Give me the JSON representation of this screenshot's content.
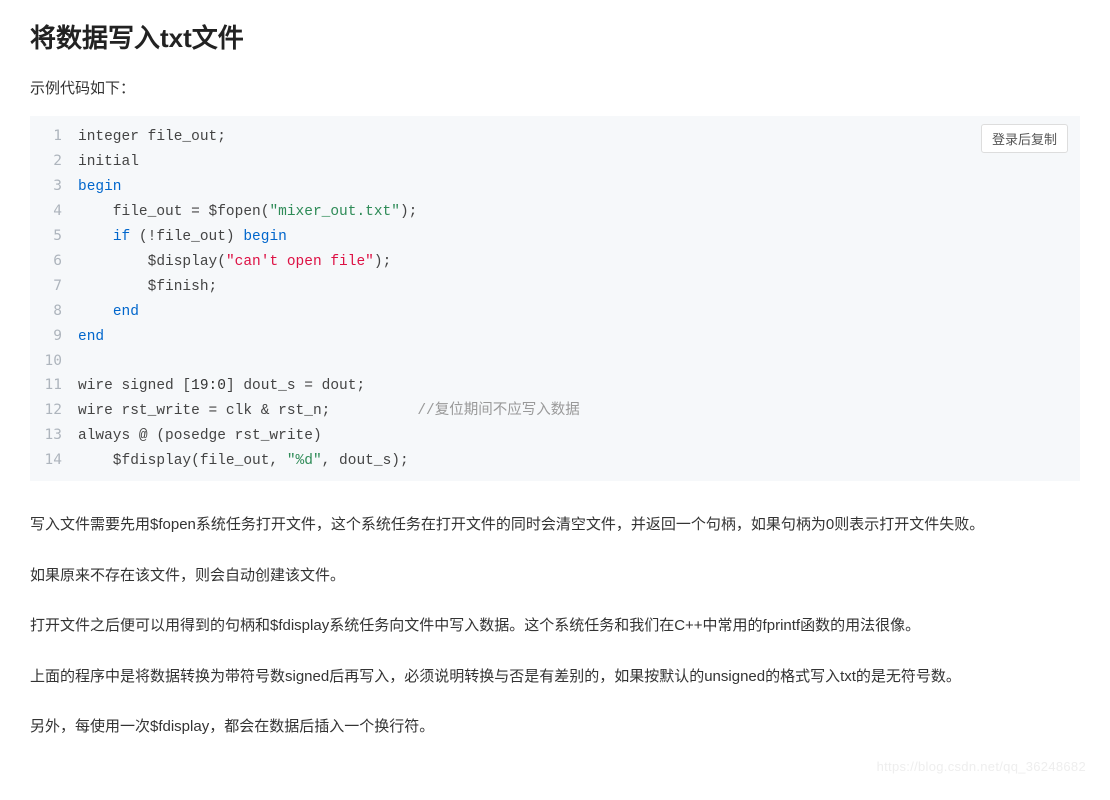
{
  "heading": "将数据写入txt文件",
  "intro": "示例代码如下：",
  "copy_label": "登录后复制",
  "code_lines": [
    {
      "n": "1",
      "type": "plain",
      "text": "integer file_out;"
    },
    {
      "n": "2",
      "type": "plain",
      "text": "initial"
    },
    {
      "n": "3",
      "type": "kw",
      "text": "begin"
    },
    {
      "n": "4",
      "type": "l4",
      "t1": "    file_out = $fopen(",
      "s": "\"mixer_out.txt\"",
      "t2": ");"
    },
    {
      "n": "5",
      "type": "l5",
      "t1": "    ",
      "k1": "if",
      "t2": " (!file_out) ",
      "k2": "begin"
    },
    {
      "n": "6",
      "type": "l6",
      "t1": "        $display(",
      "s": "\"can't open file\"",
      "t2": ");"
    },
    {
      "n": "7",
      "type": "plain",
      "text": "        $finish;"
    },
    {
      "n": "8",
      "type": "kw_indent",
      "ind": "    ",
      "text": "end"
    },
    {
      "n": "9",
      "type": "kw",
      "text": "end"
    },
    {
      "n": "10",
      "type": "plain",
      "text": ""
    },
    {
      "n": "11",
      "type": "l11",
      "t1": "wire signed [",
      "num": "19:0",
      "t2": "] dout_s = dout;"
    },
    {
      "n": "12",
      "type": "l12",
      "t1": "wire rst_write = clk & rst_n;          ",
      "c": "//复位期间不应写入数据"
    },
    {
      "n": "13",
      "type": "plain",
      "text": "always @ (posedge rst_write)"
    },
    {
      "n": "14",
      "type": "l14",
      "t1": "    $fdisplay(file_out, ",
      "s": "\"%d\"",
      "t2": ", dout_s);"
    }
  ],
  "paragraphs": [
    "写入文件需要先用$fopen系统任务打开文件，这个系统任务在打开文件的同时会清空文件，并返回一个句柄，如果句柄为0则表示打开文件失败。",
    "如果原来不存在该文件，则会自动创建该文件。",
    "打开文件之后便可以用得到的句柄和$fdisplay系统任务向文件中写入数据。这个系统任务和我们在C++中常用的fprintf函数的用法很像。",
    "上面的程序中是将数据转换为带符号数signed后再写入，必须说明转换与否是有差别的，如果按默认的unsigned的格式写入txt的是无符号数。",
    "另外，每使用一次$fdisplay，都会在数据后插入一个换行符。"
  ],
  "watermark": "https://blog.csdn.net/qq_36248682"
}
